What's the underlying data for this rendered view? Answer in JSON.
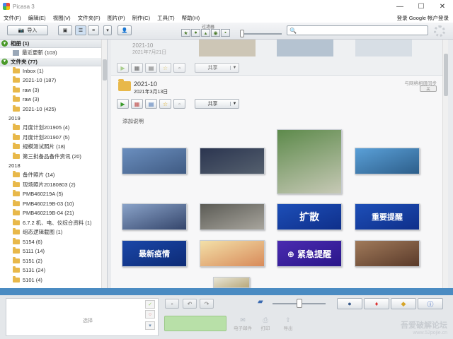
{
  "window": {
    "title": "Picasa 3",
    "controls": [
      "—",
      "☐",
      "✕"
    ]
  },
  "menu": {
    "items": [
      "文件(F)",
      "编辑(E)",
      "视图(V)",
      "文件夹(F)",
      "图片(P)",
      "制作(C)",
      "工具(T)",
      "帮助(H)"
    ],
    "signin": "登录 Google 帐户登录"
  },
  "toolbar": {
    "import_label": "导入",
    "filter_label": "过滤器",
    "search_value": "🔍"
  },
  "sidebar": {
    "albums_header": "相册 (1)",
    "albums": [
      {
        "label": "最近更新 (103)"
      }
    ],
    "folders_header": "文件夹 (77)",
    "folders_top": [
      {
        "label": "Inbox (1)"
      },
      {
        "label": "2021-10 (187)"
      },
      {
        "label": "raw (3)"
      },
      {
        "label": "raw (3)"
      },
      {
        "label": "2021-10 (425)"
      }
    ],
    "year_2019": "2019",
    "folders_2019": [
      {
        "label": "月度计划201905 (4)"
      },
      {
        "label": "月度计划201907 (5)"
      },
      {
        "label": "规模测试照片 (18)"
      },
      {
        "label": "第三批备品备件资讯 (20)"
      }
    ],
    "year_2018": "2018",
    "folders_2018": [
      {
        "label": "备件照片 (14)"
      },
      {
        "label": "现场照片20180803 (2)"
      },
      {
        "label": "PMB460219A (5)"
      },
      {
        "label": "PMB460219B-03 (10)"
      },
      {
        "label": "PMB460219B-04 (21)"
      },
      {
        "label": "6.7.2 机、电、仪综合资料 (1)"
      },
      {
        "label": "组态逻辑截图 (1)"
      },
      {
        "label": "5154 (6)"
      },
      {
        "label": "5111 (14)"
      },
      {
        "label": "5151 (2)"
      },
      {
        "label": "5131 (24)"
      },
      {
        "label": "5101 (4)"
      }
    ]
  },
  "main": {
    "prev_album": {
      "title": "2021-10",
      "date": "2021年7月21日"
    },
    "album": {
      "title": "2021-10",
      "date": "2021年3月13日",
      "sync_label": "与网络相册同步",
      "sync_toggle": "关",
      "share_label": "共享",
      "caption_placeholder": "添加说明"
    },
    "photos": [
      {
        "name": "photo-building",
        "text": "",
        "colors": [
          "#6b8fbf",
          "#3f5a82"
        ]
      },
      {
        "name": "photo-officials",
        "text": "",
        "colors": [
          "#2b3550",
          "#55606e"
        ]
      },
      {
        "name": "photo-aerial-mosque",
        "text": "",
        "colors": [
          "#5d8a4b",
          "#c7c9b6"
        ]
      },
      {
        "name": "photo-warship",
        "text": "",
        "colors": [
          "#5aa0d8",
          "#2d5e8a"
        ]
      },
      {
        "name": "photo-navy-ship",
        "text": "",
        "colors": [
          "#8aa3c9",
          "#34456b"
        ]
      },
      {
        "name": "photo-medical",
        "text": "",
        "colors": [
          "#5b5b55",
          "#a8a59d"
        ]
      },
      {
        "name": "photo-spread-banner",
        "text": "扩散",
        "colors": [
          "#1d4fb8",
          "#0f2f8a"
        ]
      },
      {
        "name": "photo-important-notice",
        "text": "重要提醒",
        "colors": [
          "#1d4fb8",
          "#0f2f8a"
        ]
      },
      {
        "name": "photo-latest-epidemic",
        "text": "最新疫情",
        "colors": [
          "#1a47a8",
          "#0d2b76"
        ]
      },
      {
        "name": "photo-heatmap",
        "text": "",
        "colors": [
          "#f3e0a8",
          "#d88a5a"
        ]
      },
      {
        "name": "photo-urgent-alert",
        "text": "⊕ 紧急提醒",
        "colors": [
          "#4a2bb0",
          "#2a168a"
        ]
      },
      {
        "name": "photo-portraits",
        "text": "",
        "colors": [
          "#a07a5a",
          "#5a3a2a"
        ]
      },
      {
        "name": "photo-document",
        "text": "",
        "colors": [
          "#e8e6d8",
          "#b8a87a"
        ]
      }
    ]
  },
  "tray": {
    "label": "选择",
    "actions": [
      "电子邮件",
      "打印",
      "导出"
    ]
  },
  "watermark": {
    "line1": "吾爱破解论坛",
    "line2": "www.52pojie.cn"
  }
}
